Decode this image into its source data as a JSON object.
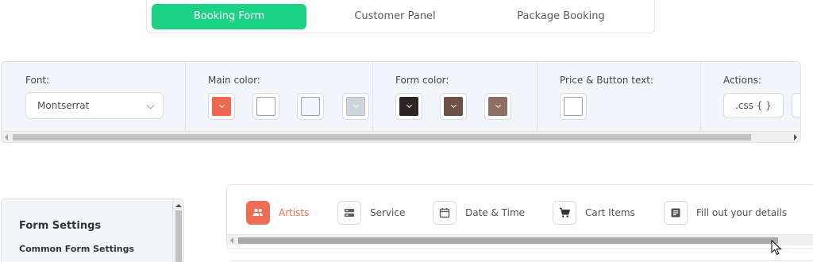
{
  "tabs": [
    {
      "label": "Booking Form",
      "active": true
    },
    {
      "label": "Customer Panel",
      "active": false
    },
    {
      "label": "Package Booking",
      "active": false
    }
  ],
  "toolbar": {
    "font": {
      "label": "Font:",
      "value": "Montserrat"
    },
    "main_color": {
      "label": "Main color:",
      "colors": [
        "#f0674f",
        "#ffffff",
        "#f2f5f9",
        "#cfd3db"
      ]
    },
    "form_color": {
      "label": "Form color:",
      "colors": [
        "#2f2424",
        "#6e5049",
        "#8e6d63"
      ]
    },
    "price_text": {
      "label": "Price & Button text:",
      "colors": [
        "#ffffff"
      ]
    },
    "actions": {
      "label": "Actions:",
      "css_button": ".css { }"
    }
  },
  "sidebar": {
    "title": "Form Settings",
    "subtitle": "Common Form Settings"
  },
  "steps": [
    {
      "label": "Artists",
      "icon": "users-icon",
      "active": true
    },
    {
      "label": "Service",
      "icon": "service-icon",
      "active": false
    },
    {
      "label": "Date & Time",
      "icon": "calendar-icon",
      "active": false
    },
    {
      "label": "Cart Items",
      "icon": "cart-icon",
      "active": false
    },
    {
      "label": "Fill out your details",
      "icon": "details-icon",
      "active": false
    }
  ],
  "colors": {
    "accent": "#1bd186",
    "step_active": "#ee6e55"
  }
}
